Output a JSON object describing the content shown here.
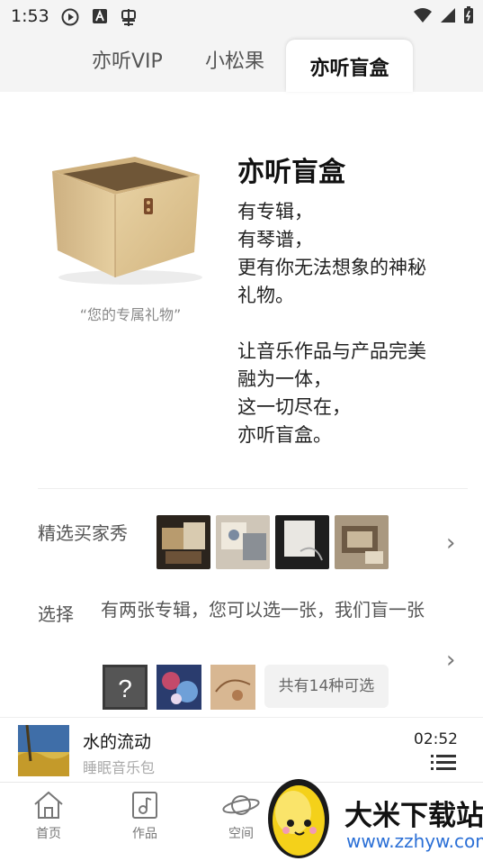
{
  "status": {
    "time": "1:53"
  },
  "tabs": [
    {
      "label": "亦听VIP"
    },
    {
      "label": "小松果"
    },
    {
      "label": "亦听盲盒",
      "active": true
    }
  ],
  "intro": {
    "caption": "“您的专属礼物”",
    "title": "亦听盲盒",
    "lines": [
      "有专辑，",
      "有琴谱，",
      "更有你无法想象的神秘",
      "礼物。",
      "",
      "让音乐作品与产品完美",
      "融为一体，",
      "这一切尽在，",
      "亦听盲盒。"
    ]
  },
  "buyer_show": {
    "label": "精选买家秀"
  },
  "choose": {
    "label": "选择",
    "text": "有两张专辑，您可以选一张，我们盲一张",
    "count": "共有14种可选"
  },
  "player": {
    "title": "水的流动",
    "subtitle": "睡眠音乐包",
    "time": "02:52"
  },
  "nav": [
    {
      "label": "首页"
    },
    {
      "label": "作品"
    },
    {
      "label": "空间"
    }
  ],
  "watermark": {
    "name": "大米下载站",
    "url": "www.zzhyw.com"
  },
  "colors": {
    "accent": "#2a6fd6",
    "tab_bg": "#f4f4f4"
  }
}
